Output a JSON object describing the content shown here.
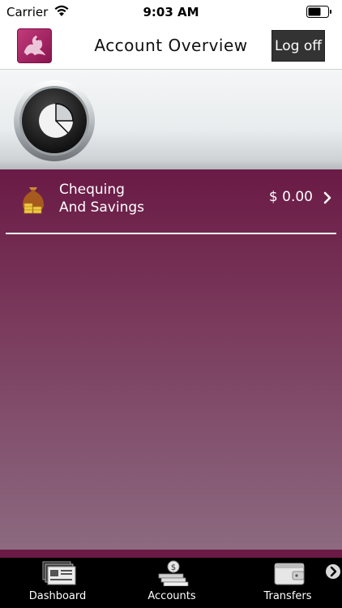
{
  "status_bar": {
    "carrier": "Carrier",
    "time": "9:03 AM"
  },
  "header": {
    "title": "Account Overview",
    "logoff_label": "Log off"
  },
  "accounts": [
    {
      "name_line1": "Chequing",
      "name_line2": "And Savings",
      "balance": "$ 0.00"
    }
  ],
  "tabs": [
    {
      "label": "Dashboard",
      "icon": "dashboard-icon"
    },
    {
      "label": "Accounts",
      "icon": "cash-stack-icon"
    },
    {
      "label": "Transfers",
      "icon": "wallet-icon"
    }
  ],
  "colors": {
    "brand": "#6a1a45",
    "header_bg": "#ffffff",
    "tab_bar_bg": "#000000"
  }
}
